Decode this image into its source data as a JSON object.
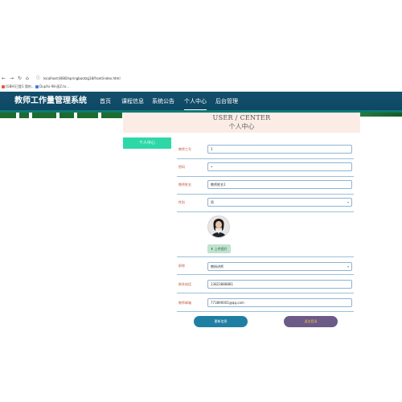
{
  "browser": {
    "back_glyph": "←",
    "forward_glyph": "→",
    "reload_glyph": "↻",
    "home_glyph": "⌂",
    "lock_glyph": "ⓘ",
    "url": "localhost:8080/springbootzg18/front/index.html",
    "bookmarks": [
      {
        "label": "[GBH]已登1 我的...",
        "color": "#e35a3a"
      },
      {
        "label": "DupXx-98-面Z.to...",
        "color": "#3a7be3"
      }
    ]
  },
  "nav": {
    "system_title": "教师工作量管理系统",
    "items": [
      {
        "label": "首页"
      },
      {
        "label": "课程信息"
      },
      {
        "label": "系统公告"
      },
      {
        "label": "个人中心",
        "active": true
      },
      {
        "label": "后台管理"
      }
    ]
  },
  "header": {
    "en": "USER / CENTER",
    "cn": "个人中心"
  },
  "sidebar": {
    "items": [
      {
        "label": "个人中心",
        "active": true
      }
    ]
  },
  "form": {
    "teacher_id": {
      "label": "教师工号",
      "value": "1"
    },
    "password": {
      "label": "密码",
      "value": "•"
    },
    "teacher_name": {
      "label": "教师姓名",
      "value": "教师姓名1"
    },
    "gender": {
      "label": "性别",
      "value": "男"
    },
    "upload_label": "上传图片",
    "title_field": {
      "label": "职称",
      "value": "教授讲师"
    },
    "phone": {
      "label": "联系电话",
      "value": "13823888881"
    },
    "email": {
      "label": "教师邮箱",
      "value": "773890001@qq.com"
    }
  },
  "buttons": {
    "update": "更新信息",
    "logout": "退出登录"
  },
  "colors": {
    "nav_bg": "#14506d",
    "sidebar_active": "#2ed8a6",
    "update_btn": "#1f7fa3",
    "logout_btn": "#6b5b86",
    "label_color": "#c05a3a"
  }
}
